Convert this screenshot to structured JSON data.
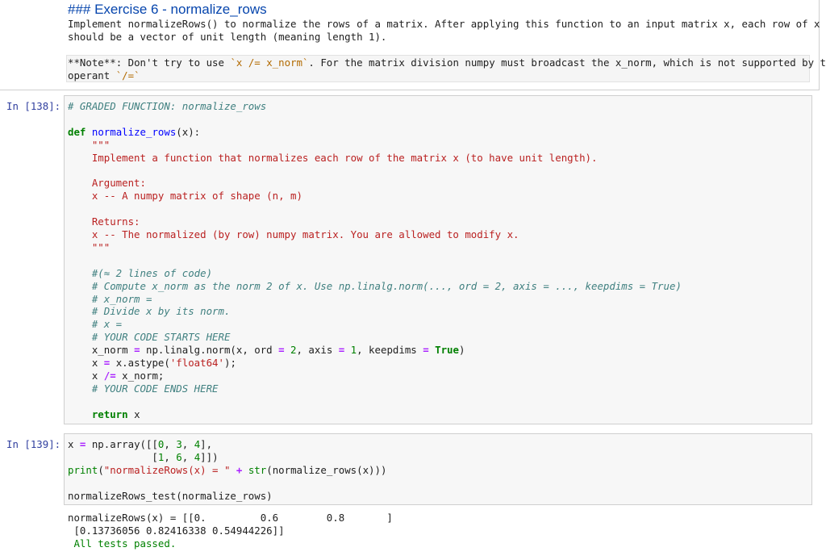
{
  "markdown": {
    "heading": "### Exercise 6 - normalize_rows",
    "description_line1": "Implement normalizeRows() to normalize the rows of a matrix. After applying this function to an input matrix x, each row of x",
    "description_line2": "should be a vector of unit length (meaning length 1).",
    "note_label": "**Note**",
    "note_text1": ": Don't try to use ",
    "note_code1": "`x /= x_norm`",
    "note_text2": ". For the matrix division numpy must broadcast the x_norm, which is not supported by the",
    "note_text3": "operant ",
    "note_code2": "`/=`"
  },
  "cell1": {
    "prompt": "In [138]:",
    "lines": [
      [
        {
          "c": "cm",
          "t": "# GRADED FUNCTION: normalize_rows"
        }
      ],
      [],
      [
        {
          "c": "def",
          "t": "def"
        },
        {
          "c": "plain",
          "t": " "
        },
        {
          "c": "fn",
          "t": "normalize_rows"
        },
        {
          "c": "plain",
          "t": "(x):"
        }
      ],
      [
        {
          "c": "doc",
          "t": "    \"\"\""
        }
      ],
      [
        {
          "c": "doc",
          "t": "    Implement a function that normalizes each row of the matrix x (to have unit length)."
        }
      ],
      [],
      [
        {
          "c": "doc",
          "t": "    Argument:"
        }
      ],
      [
        {
          "c": "doc",
          "t": "    x -- A numpy matrix of shape (n, m)"
        }
      ],
      [],
      [
        {
          "c": "doc",
          "t": "    Returns:"
        }
      ],
      [
        {
          "c": "doc",
          "t": "    x -- The normalized (by row) numpy matrix. You are allowed to modify x."
        }
      ],
      [
        {
          "c": "doc",
          "t": "    \"\"\""
        }
      ],
      [],
      [
        {
          "c": "cm",
          "t": "    #(≈ 2 lines of code)"
        }
      ],
      [
        {
          "c": "cm",
          "t": "    # Compute x_norm as the norm 2 of x. Use np.linalg.norm(..., ord = 2, axis = ..., keepdims = True)"
        }
      ],
      [
        {
          "c": "cm",
          "t": "    # x_norm ="
        }
      ],
      [
        {
          "c": "cm",
          "t": "    # Divide x by its norm."
        }
      ],
      [
        {
          "c": "cm",
          "t": "    # x ="
        }
      ],
      [
        {
          "c": "cm",
          "t": "    # YOUR CODE STARTS HERE"
        }
      ],
      [
        {
          "c": "plain",
          "t": "    x_norm "
        },
        {
          "c": "op",
          "t": "="
        },
        {
          "c": "plain",
          "t": " np.linalg.norm(x, ord "
        },
        {
          "c": "op",
          "t": "="
        },
        {
          "c": "plain",
          "t": " "
        },
        {
          "c": "num",
          "t": "2"
        },
        {
          "c": "plain",
          "t": ", axis "
        },
        {
          "c": "op",
          "t": "="
        },
        {
          "c": "plain",
          "t": " "
        },
        {
          "c": "num",
          "t": "1"
        },
        {
          "c": "plain",
          "t": ", keepdims "
        },
        {
          "c": "op",
          "t": "="
        },
        {
          "c": "plain",
          "t": " "
        },
        {
          "c": "kw",
          "t": "True"
        },
        {
          "c": "plain",
          "t": ")"
        }
      ],
      [
        {
          "c": "plain",
          "t": "    x "
        },
        {
          "c": "op",
          "t": "="
        },
        {
          "c": "plain",
          "t": " x.astype("
        },
        {
          "c": "str",
          "t": "'float64'"
        },
        {
          "c": "plain",
          "t": ");"
        }
      ],
      [
        {
          "c": "plain",
          "t": "    x "
        },
        {
          "c": "op",
          "t": "/="
        },
        {
          "c": "plain",
          "t": " x_norm;"
        }
      ],
      [
        {
          "c": "cm",
          "t": "    # YOUR CODE ENDS HERE"
        }
      ],
      [],
      [
        {
          "c": "kw",
          "t": "    return"
        },
        {
          "c": "plain",
          "t": " x"
        }
      ]
    ]
  },
  "cell2": {
    "prompt": "In [139]:",
    "lines": [
      [
        {
          "c": "plain",
          "t": "x "
        },
        {
          "c": "op",
          "t": "="
        },
        {
          "c": "plain",
          "t": " np.array([["
        },
        {
          "c": "num",
          "t": "0"
        },
        {
          "c": "plain",
          "t": ", "
        },
        {
          "c": "num",
          "t": "3"
        },
        {
          "c": "plain",
          "t": ", "
        },
        {
          "c": "num",
          "t": "4"
        },
        {
          "c": "plain",
          "t": "],"
        }
      ],
      [
        {
          "c": "plain",
          "t": "              ["
        },
        {
          "c": "num",
          "t": "1"
        },
        {
          "c": "plain",
          "t": ", "
        },
        {
          "c": "num",
          "t": "6"
        },
        {
          "c": "plain",
          "t": ", "
        },
        {
          "c": "num",
          "t": "4"
        },
        {
          "c": "plain",
          "t": "]])"
        }
      ],
      [
        {
          "c": "bi",
          "t": "print"
        },
        {
          "c": "plain",
          "t": "("
        },
        {
          "c": "str",
          "t": "\"normalizeRows(x) = \""
        },
        {
          "c": "plain",
          "t": " "
        },
        {
          "c": "op",
          "t": "+"
        },
        {
          "c": "plain",
          "t": " "
        },
        {
          "c": "bi",
          "t": "str"
        },
        {
          "c": "plain",
          "t": "(normalize_rows(x)))"
        }
      ],
      [],
      [
        {
          "c": "plain",
          "t": "normalizeRows_test(normalize_rows)"
        }
      ]
    ]
  },
  "output": {
    "lines": [
      "normalizeRows(x) = [[0.         0.6        0.8       ]",
      " [0.13736056 0.82416338 0.54944226]]",
      " All tests passed."
    ],
    "success_color": "#008000"
  }
}
